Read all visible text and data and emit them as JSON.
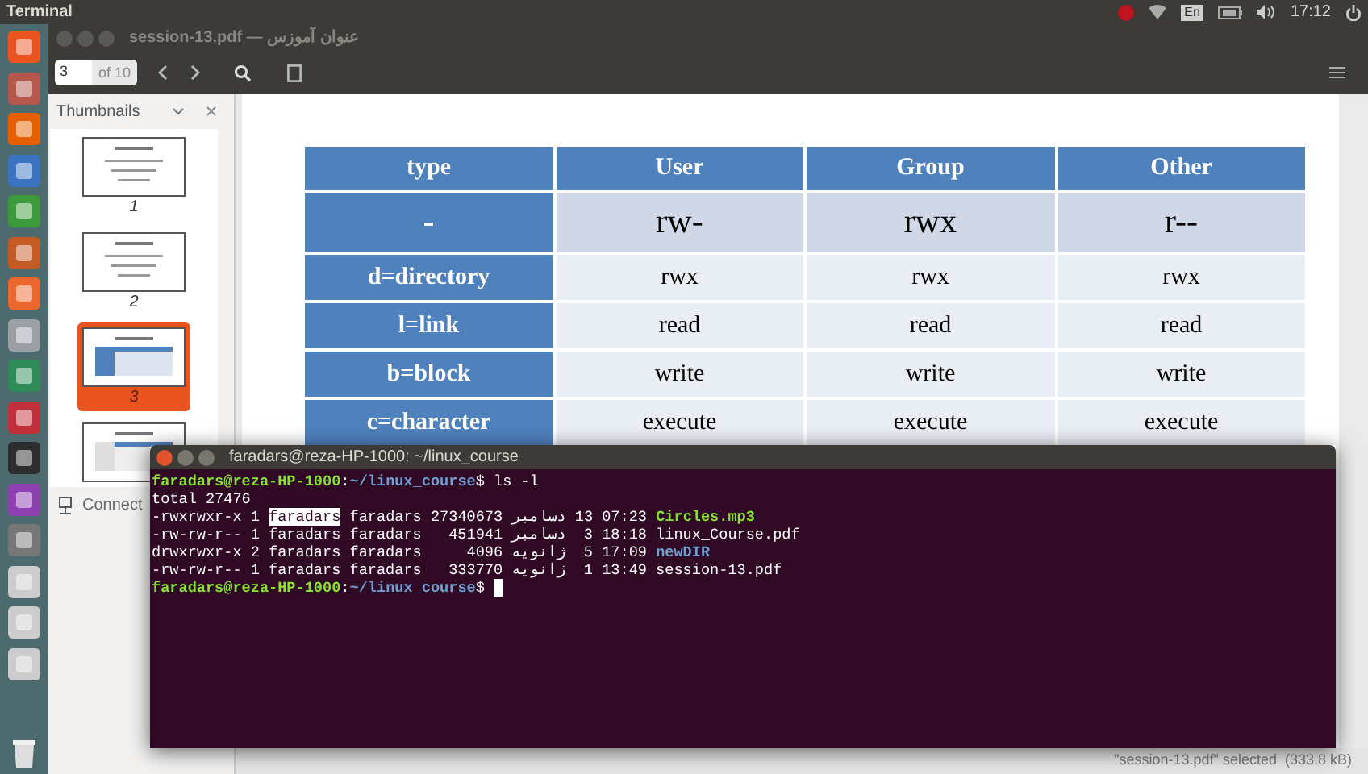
{
  "top_panel": {
    "app_name": "Terminal",
    "keyboard_layout": "En",
    "clock": "17:12"
  },
  "viewer": {
    "title": "session-13.pdf — عنوان آموزس",
    "page_field": {
      "value": "3"
    },
    "page_count": "of 10",
    "sidebar": {
      "title": "Thumbnails",
      "thumbnails": [
        {
          "label": "1",
          "selected": false
        },
        {
          "label": "2",
          "selected": false
        },
        {
          "label": "3",
          "selected": true
        },
        {
          "selected": false
        }
      ],
      "connect_label": "Connect"
    },
    "slide_table": {
      "columns": [
        "type",
        "User",
        "Group",
        "Other"
      ],
      "rows": [
        {
          "kind": "large",
          "cells": [
            "-",
            "rw-",
            "rwx",
            "r--"
          ]
        },
        {
          "kind": "normal",
          "cells": [
            "d=directory",
            "rwx",
            "rwx",
            "rwx"
          ]
        },
        {
          "kind": "normal",
          "cells": [
            "l=link",
            "read",
            "read",
            "read"
          ]
        },
        {
          "kind": "normal",
          "cells": [
            "b=block",
            "write",
            "write",
            "write"
          ]
        },
        {
          "kind": "normal",
          "cells": [
            "c=character",
            "execute",
            "execute",
            "execute"
          ]
        }
      ]
    },
    "status_bar": "\"session-13.pdf\" selected  (333.8 kB)"
  },
  "terminal": {
    "title": "faradars@reza-HP-1000: ~/linux_course",
    "lines": [
      {
        "cursor": false,
        "segments": [
          {
            "kind": "user",
            "text": "faradars@reza-HP-1000"
          },
          {
            "kind": "plain",
            "text": ":"
          },
          {
            "kind": "path",
            "text": "~/linux_course"
          },
          {
            "kind": "plain",
            "text": "$ ls -l"
          }
        ]
      },
      {
        "cursor": false,
        "segments": [
          {
            "kind": "plain",
            "text": "total 27476"
          }
        ]
      },
      {
        "cursor": false,
        "segments": [
          {
            "kind": "plain",
            "text": "-rwxrwxr-x 1 "
          },
          {
            "kind": "selected",
            "text": "faradars"
          },
          {
            "kind": "plain",
            "text": " faradars 27340673 "
          },
          {
            "kind": "plain",
            "text": "دسامبر"
          },
          {
            "kind": "plain",
            "text": " 13 07:23 "
          },
          {
            "kind": "exec",
            "text": "Circles.mp3"
          }
        ]
      },
      {
        "cursor": false,
        "segments": [
          {
            "kind": "plain",
            "text": "-rw-rw-r-- 1 faradars faradars   451941 "
          },
          {
            "kind": "plain",
            "text": "دسامبر"
          },
          {
            "kind": "plain",
            "text": "  3 18:18 linux_Course.pdf"
          }
        ]
      },
      {
        "cursor": false,
        "segments": [
          {
            "kind": "plain",
            "text": "drwxrwxr-x 2 faradars faradars     4096 "
          },
          {
            "kind": "plain",
            "text": "ژانویه"
          },
          {
            "kind": "plain",
            "text": "  5 17:09 "
          },
          {
            "kind": "dir",
            "text": "newDIR"
          }
        ]
      },
      {
        "cursor": false,
        "segments": [
          {
            "kind": "plain",
            "text": "-rw-rw-r-- 1 faradars faradars   333770 "
          },
          {
            "kind": "plain",
            "text": "ژانویه"
          },
          {
            "kind": "plain",
            "text": "  1 13:49 session-13.pdf"
          }
        ]
      },
      {
        "cursor": true,
        "segments": [
          {
            "kind": "user",
            "text": "faradars@reza-HP-1000"
          },
          {
            "kind": "plain",
            "text": ":"
          },
          {
            "kind": "path",
            "text": "~/linux_course"
          },
          {
            "kind": "plain",
            "text": "$ "
          }
        ]
      }
    ]
  }
}
